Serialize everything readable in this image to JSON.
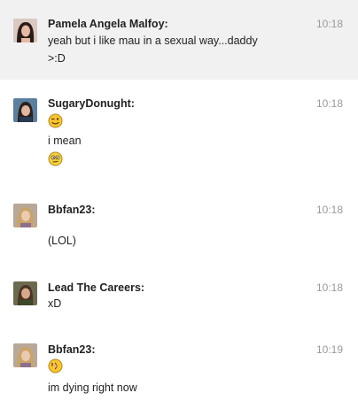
{
  "messages": [
    {
      "sender": "Pamela Angela Malfoy:",
      "time": "10:18",
      "lines": [
        "yeah but i like mau in a sexual way...daddy",
        ">:D"
      ]
    },
    {
      "sender": "SugaryDonught:",
      "time": "10:18",
      "lines": [
        "i mean"
      ],
      "emoji": [
        "wink-smiley-icon",
        "confused-smiley-icon"
      ]
    },
    {
      "sender": "Bbfan23:",
      "time": "10:18",
      "lines": [
        "(LOL)"
      ]
    },
    {
      "sender": "Lead The Careers:",
      "time": "10:18",
      "lines": [
        "xD"
      ]
    },
    {
      "sender": "Bbfan23:",
      "time": "10:19",
      "lines": [
        "im dying right now"
      ],
      "emoji": [
        "laughing-smiley-icon"
      ]
    }
  ],
  "colors": {
    "highlight_background": "#f1f1f1",
    "timestamp": "#9a9a9a",
    "emoji_yellow": "#f7c62f"
  }
}
